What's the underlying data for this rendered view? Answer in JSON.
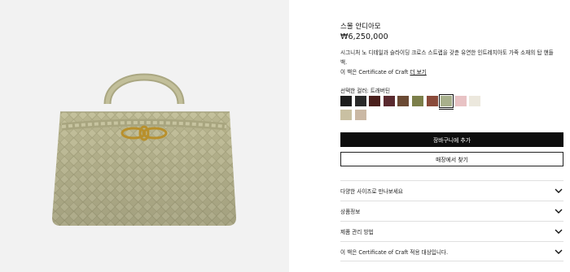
{
  "product": {
    "name": "스몰 안디아모",
    "price": "₩6,250,000",
    "description": "시그니처 노 디테일과 슬라이딩 크로스 스트랩을 갖춘 유연한 인트레치아토 가죽 소재의 탑 핸들 백.",
    "craft_text": "이 백은 Certificate of Craft",
    "craft_link": "더 보기",
    "color_label": "선택한 컬러: 트래버틴",
    "colors": [
      "#1c1c1c",
      "#2a2a2a",
      "#4a1f1c",
      "#5a2a2f",
      "#6b4a34",
      "#7c7f4a",
      "#8a4a3a",
      "#a8b08c",
      "#e8c2c4",
      "#ece8dd",
      "#c9c0a2",
      "#cab8a4"
    ],
    "selected_color_index": 7
  },
  "buttons": {
    "add_to_cart": "장바구니에 추가",
    "find_in_store": "매장에서 찾기"
  },
  "accordion": [
    "다양한 사이즈로 만나보세요",
    "상품정보",
    "제품 관리 방법",
    "이 백은 Certificate of Craft 적용 대상입니다."
  ],
  "image": {
    "bag_color": "#b7b58f",
    "hardware_color": "#b8902c",
    "background": "#f2f2f2"
  }
}
